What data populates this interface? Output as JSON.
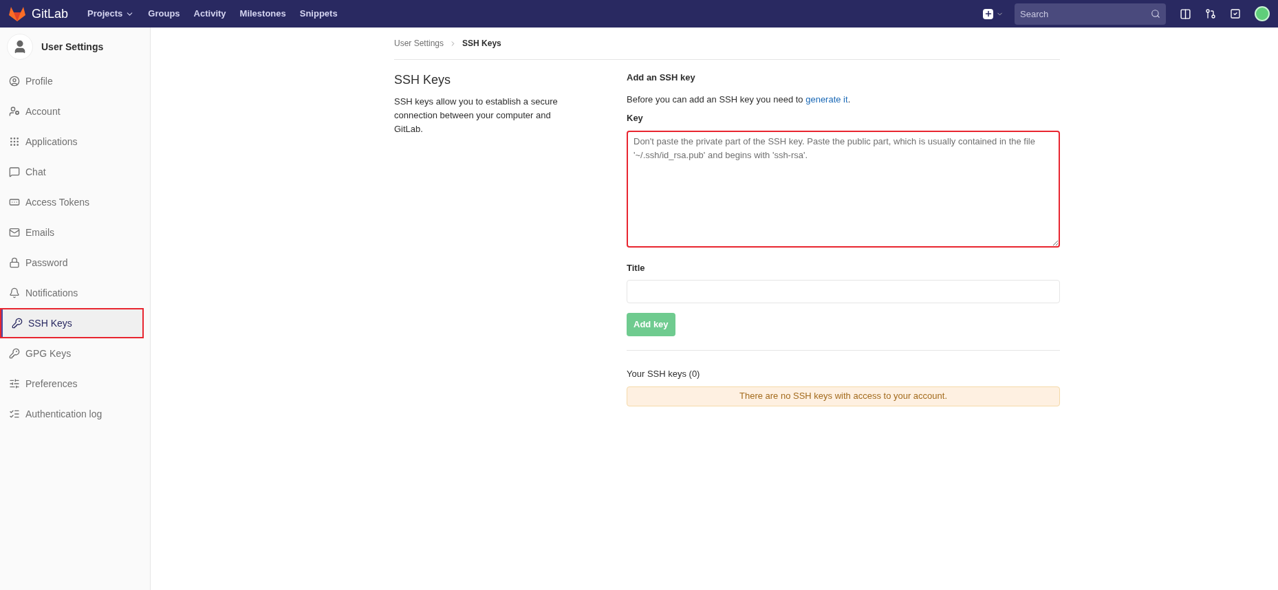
{
  "top_bar": {
    "brand": "GitLab",
    "nav": [
      {
        "label": "Projects",
        "dropdown": true
      },
      {
        "label": "Groups",
        "dropdown": false
      },
      {
        "label": "Activity",
        "dropdown": false
      },
      {
        "label": "Milestones",
        "dropdown": false
      },
      {
        "label": "Snippets",
        "dropdown": false
      }
    ],
    "search": {
      "placeholder": "Search"
    }
  },
  "sidebar": {
    "title": "User Settings",
    "items": [
      {
        "label": "Profile",
        "selected": false,
        "highlighted": false
      },
      {
        "label": "Account",
        "selected": false,
        "highlighted": false
      },
      {
        "label": "Applications",
        "selected": false,
        "highlighted": false
      },
      {
        "label": "Chat",
        "selected": false,
        "highlighted": false
      },
      {
        "label": "Access Tokens",
        "selected": false,
        "highlighted": false
      },
      {
        "label": "Emails",
        "selected": false,
        "highlighted": false
      },
      {
        "label": "Password",
        "selected": false,
        "highlighted": false
      },
      {
        "label": "Notifications",
        "selected": false,
        "highlighted": false
      },
      {
        "label": "SSH Keys",
        "selected": true,
        "highlighted": true
      },
      {
        "label": "GPG Keys",
        "selected": false,
        "highlighted": false
      },
      {
        "label": "Preferences",
        "selected": false,
        "highlighted": false
      },
      {
        "label": "Authentication log",
        "selected": false,
        "highlighted": false
      }
    ]
  },
  "breadcrumb": [
    "User Settings",
    "SSH Keys"
  ],
  "intro": {
    "title": "SSH Keys",
    "text": "SSH keys allow you to establish a secure connection between your computer and GitLab."
  },
  "form": {
    "heading": "Add an SSH key",
    "hint": "Before you can add an SSH key you need to",
    "hint_link": "generate it",
    "hint_end": ".",
    "key_label": "Key",
    "key_placeholder": "Don't paste the private part of the SSH key. Paste the public part, which is usually contained in the file '~/.ssh/id_rsa.pub' and begins with 'ssh-rsa'.",
    "key_highlighted": true,
    "title_label": "Title",
    "submit": {
      "label": "Add key",
      "disabled": true
    }
  },
  "keys": {
    "heading": "Your SSH keys (0)",
    "empty": "There are no SSH keys with access to your account."
  }
}
